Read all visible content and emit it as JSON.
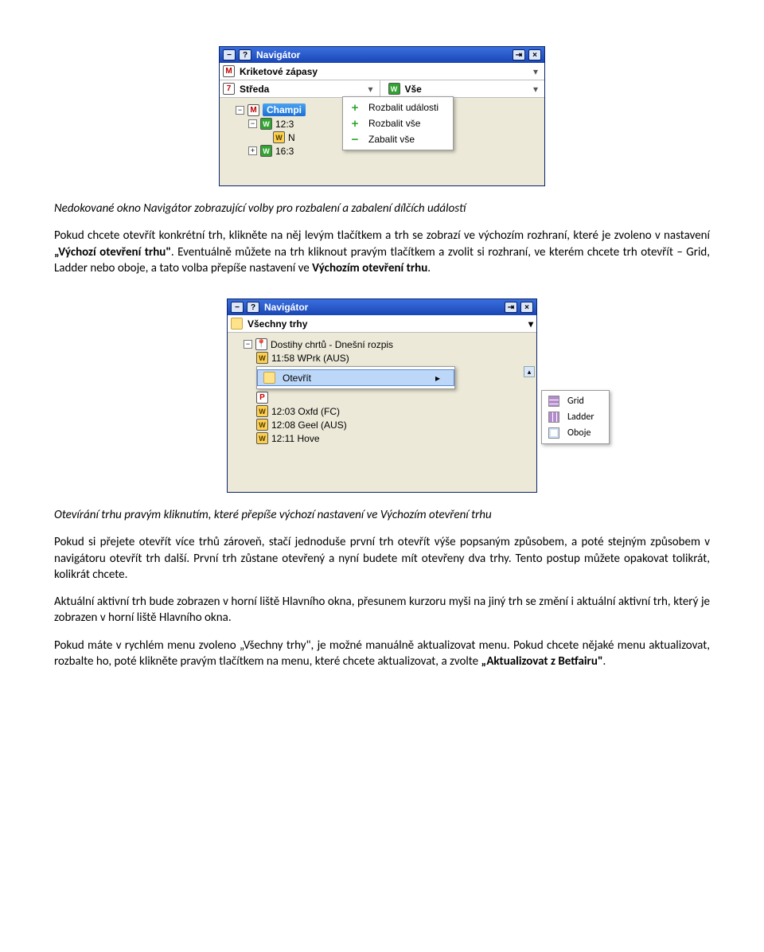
{
  "fig1": {
    "title": "Navigátor",
    "header_game": "Kriketové zápasy",
    "day_label": "Středa",
    "all_label": "Vše",
    "context": {
      "expand_events": "Rozbalit události",
      "expand_all": "Rozbalit vše",
      "collapse_all": "Zabalit vše"
    },
    "tree": {
      "champ": "Champi",
      "t1": "12:3",
      "t1_sub": "N",
      "t2": "16:3"
    }
  },
  "caption1": "Nedokované okno Navigátor zobrazující volby pro rozbalení a zabalení dílčích událostí",
  "para1a": "Pokud chcete otevřít konkrétní trh, klikněte na něj levým tlačítkem a trh se zobrazí ve výchozím rozhraní, které je zvoleno v nastavení ",
  "para1b": "„Výchozí otevření trhu",
  "para1c": ". Eventuálně můžete na trh kliknout pravým tlačítkem a zvolit si rozhraní, ve kterém chcete trh otevřít – Grid, Ladder nebo oboje, a tato volba přepíše nastavení ve ",
  "para1d": "Výchozím otevření trhu",
  "fig2": {
    "title": "Navigátor",
    "all_markets": "Všechny trhy",
    "greyhounds": "Dostihy chrtů - Dnešní rozpis",
    "rows": [
      "11:58 WPrk (AUS)",
      "12:03 Oxfd (FC)",
      "12:08 Geel (AUS)",
      "12:11 Hove"
    ],
    "open_label": "Otevřít",
    "submenu": {
      "grid": "Grid",
      "ladder": "Ladder",
      "both": "Oboje"
    }
  },
  "caption2": "Otevírání trhu pravým kliknutím, které přepíše výchozí nastavení ve Výchozím otevření trhu",
  "para2": "Pokud si přejete otevřít více trhů zároveň, stačí jednoduše první trh otevřít výše popsaným způsobem, a poté stejným způsobem v navigátoru otevřít trh další. První trh zůstane otevřený a nyní budete mít otevřeny dva trhy. Tento postup můžete opakovat tolikrát, kolikrát chcete.",
  "para3": "Aktuální aktivní trh bude zobrazen v horní liště Hlavního okna, přesunem kurzoru myši na jiný trh se změní i aktuální aktivní trh, který je zobrazen v horní liště Hlavního okna.",
  "para4a": "Pokud máte v rychlém menu zvoleno „Všechny trhy\", je možné manuálně aktualizovat menu. Pokud chcete nějaké menu aktualizovat, rozbalte ho, poté klikněte pravým tlačítkem na menu, které chcete aktualizovat, a zvolte ",
  "para4b": "„Aktualizovat z Betfairu\""
}
